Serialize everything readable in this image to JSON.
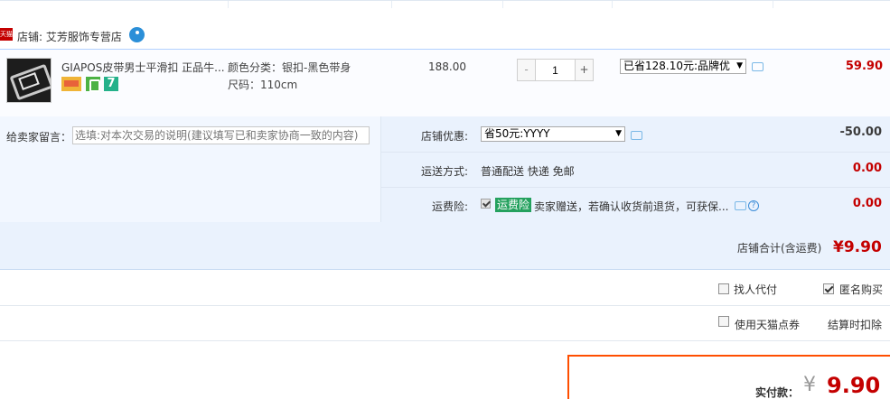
{
  "shop": {
    "icon_text": "天猫",
    "name": "店铺: 艾芳服饰专营店"
  },
  "item": {
    "title": "GIAPOS皮带男士平滑扣 正品牛...",
    "sku_color": "颜色分类：银扣-黑色带身",
    "sku_size": "尺码：110cm",
    "price": "188.00",
    "quantity": "1",
    "minus": "-",
    "plus": "+",
    "discount": "已省128.10元:品牌优",
    "total": "59.90",
    "badge_7": "7"
  },
  "options": {
    "note_label": "给卖家留言：",
    "note_placeholder": "选填:对本次交易的说明(建议填写已和卖家协商一致的内容)",
    "coupon_label": "店铺优惠:",
    "coupon_value": "省50元:YYYY",
    "coupon_amount": "-50.00",
    "shipping_label": "运送方式:",
    "shipping_value": "普通配送 快递 免邮",
    "shipping_amount": "0.00",
    "insurance_label": "运费险:",
    "insurance_tag": "运费险",
    "insurance_desc": "卖家赠送，若确认收货前退货，可获保...",
    "insurance_amount": "0.00",
    "help_mark": "?"
  },
  "shop_total": {
    "label": "店铺合计(含运费)",
    "value": "¥9.90"
  },
  "extras": {
    "proxy_pay": "找人代付",
    "anonymous": "匿名购买",
    "points": "使用天猫点券",
    "points_note": "结算时扣除",
    "anonymous_checked": true
  },
  "payment": {
    "label": "实付款：",
    "yen": "¥",
    "amount": "9.90"
  },
  "colors": {
    "accent_red": "#c40000",
    "link_blue": "#3c8dd8",
    "border_orange": "#ff4e00"
  }
}
